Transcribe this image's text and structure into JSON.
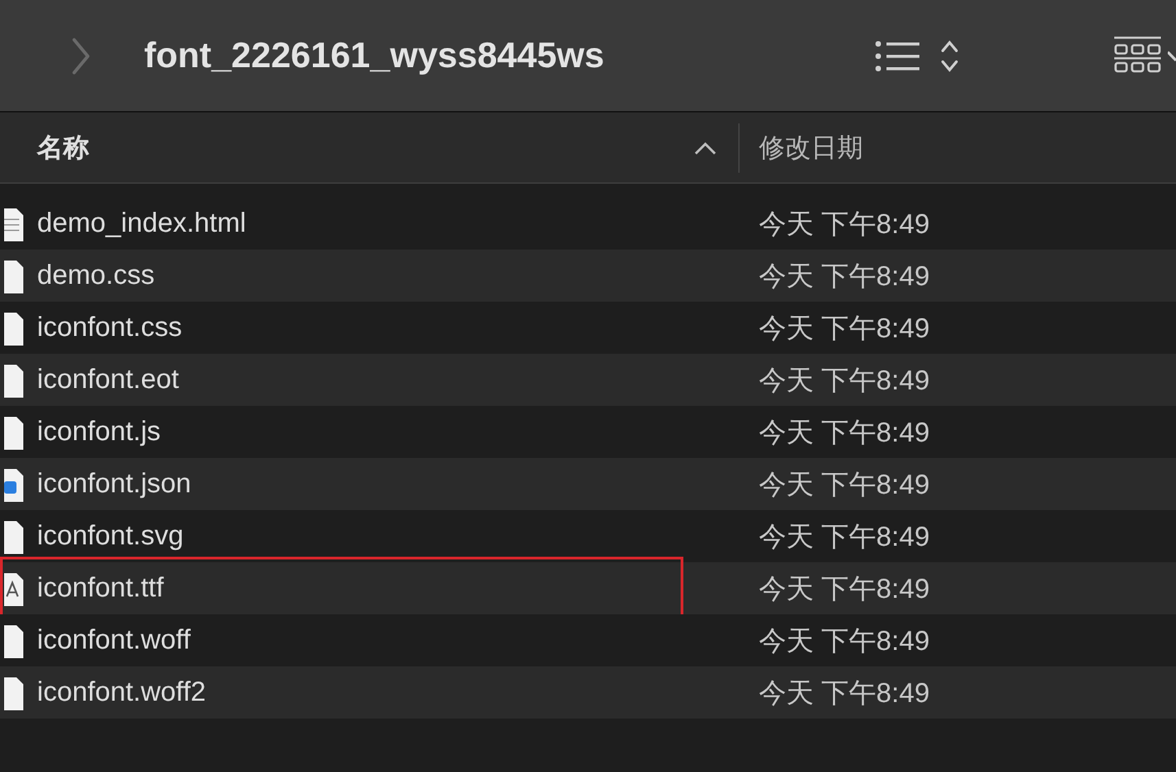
{
  "toolbar": {
    "back_disabled": true,
    "title": "font_2226161_wyss8445ws"
  },
  "columns": [
    {
      "label": "名称",
      "sorted": true
    },
    {
      "label": "修改日期",
      "sorted": false
    }
  ],
  "files": [
    {
      "name": "demo_index.html",
      "modified": "今天 下午8:49",
      "kind": "html",
      "highlighted": false
    },
    {
      "name": "demo.css",
      "modified": "今天 下午8:49",
      "kind": "file",
      "highlighted": false
    },
    {
      "name": "iconfont.css",
      "modified": "今天 下午8:49",
      "kind": "file",
      "highlighted": false
    },
    {
      "name": "iconfont.eot",
      "modified": "今天 下午8:49",
      "kind": "file",
      "highlighted": false
    },
    {
      "name": "iconfont.js",
      "modified": "今天 下午8:49",
      "kind": "file",
      "highlighted": false
    },
    {
      "name": "iconfont.json",
      "modified": "今天 下午8:49",
      "kind": "json",
      "highlighted": false
    },
    {
      "name": "iconfont.svg",
      "modified": "今天 下午8:49",
      "kind": "file",
      "highlighted": false
    },
    {
      "name": "iconfont.ttf",
      "modified": "今天 下午8:49",
      "kind": "font",
      "highlighted": true
    },
    {
      "name": "iconfont.woff",
      "modified": "今天 下午8:49",
      "kind": "file",
      "highlighted": false
    },
    {
      "name": "iconfont.woff2",
      "modified": "今天 下午8:49",
      "kind": "file",
      "highlighted": false
    }
  ]
}
